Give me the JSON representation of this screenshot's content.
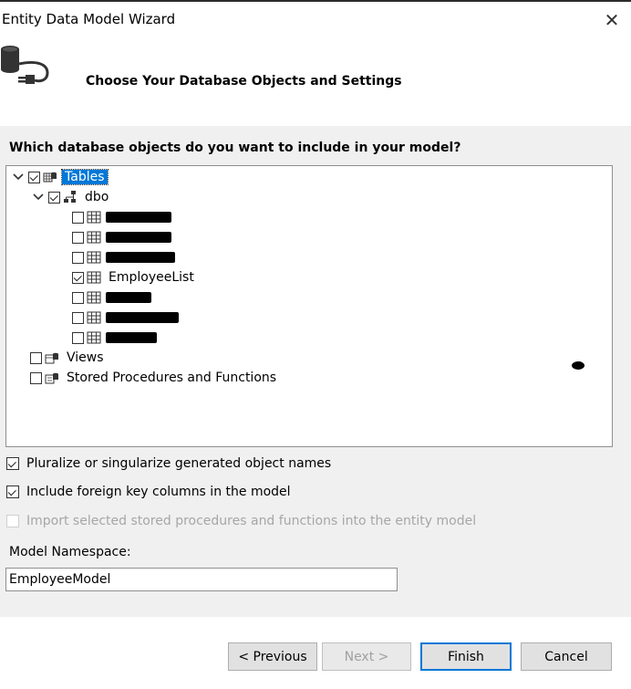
{
  "window": {
    "title": "Entity Data Model Wizard",
    "close_glyph": "✕"
  },
  "header": {
    "heading": "Choose Your Database Objects and Settings",
    "icon": "database-plug-icon"
  },
  "main": {
    "question": "Which database objects do you want to include in your model?",
    "tree": {
      "tables": {
        "label": "Tables",
        "checked": true,
        "selected": true
      },
      "schema": {
        "label": "dbo",
        "checked": true
      },
      "visible_table": {
        "label": "EmployeeList",
        "checked": true
      },
      "views": {
        "label": "Views",
        "checked": false
      },
      "procs": {
        "label": "Stored Procedures and Functions",
        "checked": false
      }
    },
    "options": {
      "pluralize": {
        "label": "Pluralize or singularize generated object names",
        "checked": true
      },
      "foreign_keys": {
        "label": "Include foreign key columns in the model",
        "checked": true
      },
      "import_procs": {
        "label": "Import selected stored procedures and functions into the entity model",
        "checked": false,
        "disabled": true
      }
    },
    "namespace": {
      "label": "Model Namespace:",
      "value": "EmployeeModel"
    }
  },
  "footer": {
    "previous": "< Previous",
    "next": "Next >",
    "finish": "Finish",
    "cancel": "Cancel"
  }
}
